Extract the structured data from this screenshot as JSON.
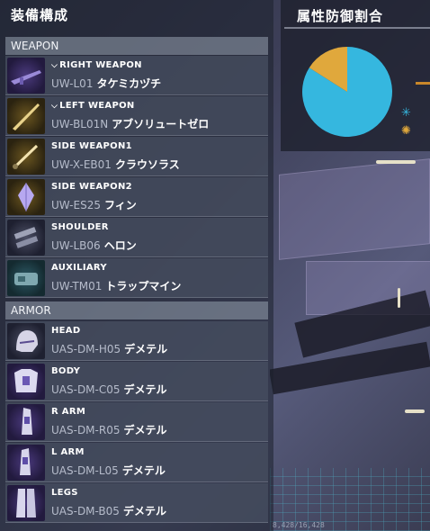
{
  "panel": {
    "title": "装備構成"
  },
  "sections": {
    "weapon": "WEAPON",
    "armor": "ARMOR"
  },
  "weapons": [
    {
      "slot": "RIGHT WEAPON",
      "code": "UW-L01",
      "name": "タケミカヅチ",
      "chevron": true
    },
    {
      "slot": "LEFT WEAPON",
      "code": "UW-BL01N",
      "name": "アブソリュートゼロ",
      "chevron": true
    },
    {
      "slot": "SIDE WEAPON1",
      "code": "UW-X-EB01",
      "name": "クラウソラス",
      "chevron": false
    },
    {
      "slot": "SIDE WEAPON2",
      "code": "UW-ES25",
      "name": "フィン",
      "chevron": false
    },
    {
      "slot": "SHOULDER",
      "code": "UW-LB06",
      "name": "ヘロン",
      "chevron": false
    },
    {
      "slot": "AUXILIARY",
      "code": "UW-TM01",
      "name": "トラップマイン",
      "chevron": false
    }
  ],
  "armor": [
    {
      "slot": "HEAD",
      "code": "UAS-DM-H05",
      "name": "デメテル"
    },
    {
      "slot": "BODY",
      "code": "UAS-DM-C05",
      "name": "デメテル"
    },
    {
      "slot": "R ARM",
      "code": "UAS-DM-R05",
      "name": "デメテル"
    },
    {
      "slot": "L ARM",
      "code": "UAS-DM-L05",
      "name": "デメテル"
    },
    {
      "slot": "LEGS",
      "code": "UAS-DM-B05",
      "name": "デメテル"
    }
  ],
  "attribute_panel": {
    "title": "属性防御割合",
    "icons": [
      "ice-icon",
      "fire-icon"
    ],
    "colors": {
      "ice": "#35b7df",
      "fire": "#e0a83c"
    }
  },
  "chart_data": {
    "type": "pie",
    "slices": [
      {
        "label": "ice",
        "value": 0.84,
        "color": "#35b7df"
      },
      {
        "label": "fire",
        "value": 0.16,
        "color": "#e0a83c"
      }
    ]
  },
  "footer": {
    "counter": "8,428/16,428"
  }
}
